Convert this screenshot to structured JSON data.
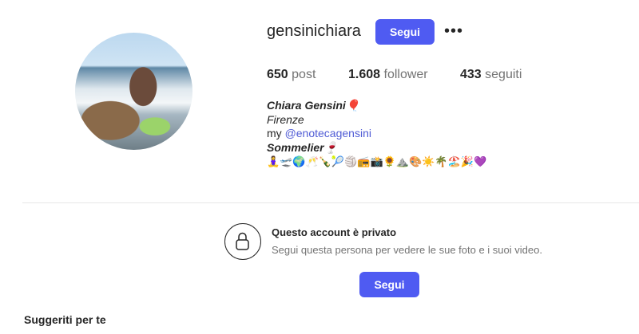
{
  "profile": {
    "username": "gensinichiara",
    "follow_label": "Segui",
    "more_label": "•••"
  },
  "stats": {
    "posts_count": "650",
    "posts_label": "post",
    "followers_count": "1.608",
    "followers_label": "follower",
    "following_count": "433",
    "following_label": "seguiti"
  },
  "bio": {
    "name": "Chiara Gensini🎈",
    "city": "Firenze",
    "link_prefix": "my ",
    "link_handle": "@enotecagensini",
    "role": "Sommelier🍷",
    "emoji_line": "🧘‍♀️🛫🌍🥂🍾🎾🏐📻📸🌻⛰️🎨☀️🌴🏖️🎉💜"
  },
  "private": {
    "title": "Questo account è privato",
    "subtitle": "Segui questa persona per vedere le sue foto e i suoi video.",
    "follow_label": "Segui"
  },
  "suggested": {
    "title": "Suggeriti per te"
  },
  "colors": {
    "accent": "#4f5bf2",
    "link": "#4f5bd5"
  }
}
